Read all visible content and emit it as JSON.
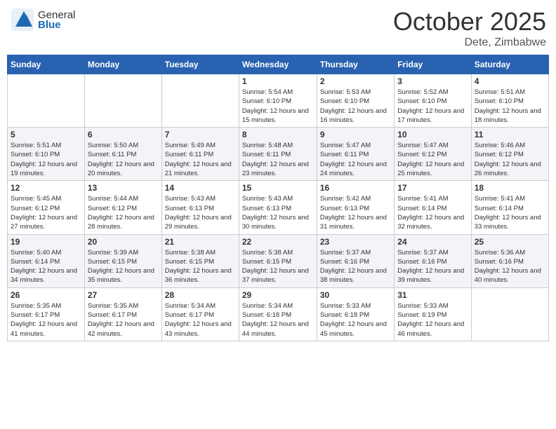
{
  "header": {
    "logo_general": "General",
    "logo_blue": "Blue",
    "month": "October 2025",
    "location": "Dete, Zimbabwe"
  },
  "weekdays": [
    "Sunday",
    "Monday",
    "Tuesday",
    "Wednesday",
    "Thursday",
    "Friday",
    "Saturday"
  ],
  "weeks": [
    [
      {
        "day": "",
        "info": ""
      },
      {
        "day": "",
        "info": ""
      },
      {
        "day": "",
        "info": ""
      },
      {
        "day": "1",
        "info": "Sunrise: 5:54 AM\nSunset: 6:10 PM\nDaylight: 12 hours and 15 minutes."
      },
      {
        "day": "2",
        "info": "Sunrise: 5:53 AM\nSunset: 6:10 PM\nDaylight: 12 hours and 16 minutes."
      },
      {
        "day": "3",
        "info": "Sunrise: 5:52 AM\nSunset: 6:10 PM\nDaylight: 12 hours and 17 minutes."
      },
      {
        "day": "4",
        "info": "Sunrise: 5:51 AM\nSunset: 6:10 PM\nDaylight: 12 hours and 18 minutes."
      }
    ],
    [
      {
        "day": "5",
        "info": "Sunrise: 5:51 AM\nSunset: 6:10 PM\nDaylight: 12 hours and 19 minutes."
      },
      {
        "day": "6",
        "info": "Sunrise: 5:50 AM\nSunset: 6:11 PM\nDaylight: 12 hours and 20 minutes."
      },
      {
        "day": "7",
        "info": "Sunrise: 5:49 AM\nSunset: 6:11 PM\nDaylight: 12 hours and 21 minutes."
      },
      {
        "day": "8",
        "info": "Sunrise: 5:48 AM\nSunset: 6:11 PM\nDaylight: 12 hours and 23 minutes."
      },
      {
        "day": "9",
        "info": "Sunrise: 5:47 AM\nSunset: 6:11 PM\nDaylight: 12 hours and 24 minutes."
      },
      {
        "day": "10",
        "info": "Sunrise: 5:47 AM\nSunset: 6:12 PM\nDaylight: 12 hours and 25 minutes."
      },
      {
        "day": "11",
        "info": "Sunrise: 5:46 AM\nSunset: 6:12 PM\nDaylight: 12 hours and 26 minutes."
      }
    ],
    [
      {
        "day": "12",
        "info": "Sunrise: 5:45 AM\nSunset: 6:12 PM\nDaylight: 12 hours and 27 minutes."
      },
      {
        "day": "13",
        "info": "Sunrise: 5:44 AM\nSunset: 6:12 PM\nDaylight: 12 hours and 28 minutes."
      },
      {
        "day": "14",
        "info": "Sunrise: 5:43 AM\nSunset: 6:13 PM\nDaylight: 12 hours and 29 minutes."
      },
      {
        "day": "15",
        "info": "Sunrise: 5:43 AM\nSunset: 6:13 PM\nDaylight: 12 hours and 30 minutes."
      },
      {
        "day": "16",
        "info": "Sunrise: 5:42 AM\nSunset: 6:13 PM\nDaylight: 12 hours and 31 minutes."
      },
      {
        "day": "17",
        "info": "Sunrise: 5:41 AM\nSunset: 6:14 PM\nDaylight: 12 hours and 32 minutes."
      },
      {
        "day": "18",
        "info": "Sunrise: 5:41 AM\nSunset: 6:14 PM\nDaylight: 12 hours and 33 minutes."
      }
    ],
    [
      {
        "day": "19",
        "info": "Sunrise: 5:40 AM\nSunset: 6:14 PM\nDaylight: 12 hours and 34 minutes."
      },
      {
        "day": "20",
        "info": "Sunrise: 5:39 AM\nSunset: 6:15 PM\nDaylight: 12 hours and 35 minutes."
      },
      {
        "day": "21",
        "info": "Sunrise: 5:38 AM\nSunset: 6:15 PM\nDaylight: 12 hours and 36 minutes."
      },
      {
        "day": "22",
        "info": "Sunrise: 5:38 AM\nSunset: 6:15 PM\nDaylight: 12 hours and 37 minutes."
      },
      {
        "day": "23",
        "info": "Sunrise: 5:37 AM\nSunset: 6:16 PM\nDaylight: 12 hours and 38 minutes."
      },
      {
        "day": "24",
        "info": "Sunrise: 5:37 AM\nSunset: 6:16 PM\nDaylight: 12 hours and 39 minutes."
      },
      {
        "day": "25",
        "info": "Sunrise: 5:36 AM\nSunset: 6:16 PM\nDaylight: 12 hours and 40 minutes."
      }
    ],
    [
      {
        "day": "26",
        "info": "Sunrise: 5:35 AM\nSunset: 6:17 PM\nDaylight: 12 hours and 41 minutes."
      },
      {
        "day": "27",
        "info": "Sunrise: 5:35 AM\nSunset: 6:17 PM\nDaylight: 12 hours and 42 minutes."
      },
      {
        "day": "28",
        "info": "Sunrise: 5:34 AM\nSunset: 6:17 PM\nDaylight: 12 hours and 43 minutes."
      },
      {
        "day": "29",
        "info": "Sunrise: 5:34 AM\nSunset: 6:18 PM\nDaylight: 12 hours and 44 minutes."
      },
      {
        "day": "30",
        "info": "Sunrise: 5:33 AM\nSunset: 6:18 PM\nDaylight: 12 hours and 45 minutes."
      },
      {
        "day": "31",
        "info": "Sunrise: 5:33 AM\nSunset: 6:19 PM\nDaylight: 12 hours and 46 minutes."
      },
      {
        "day": "",
        "info": ""
      }
    ]
  ]
}
